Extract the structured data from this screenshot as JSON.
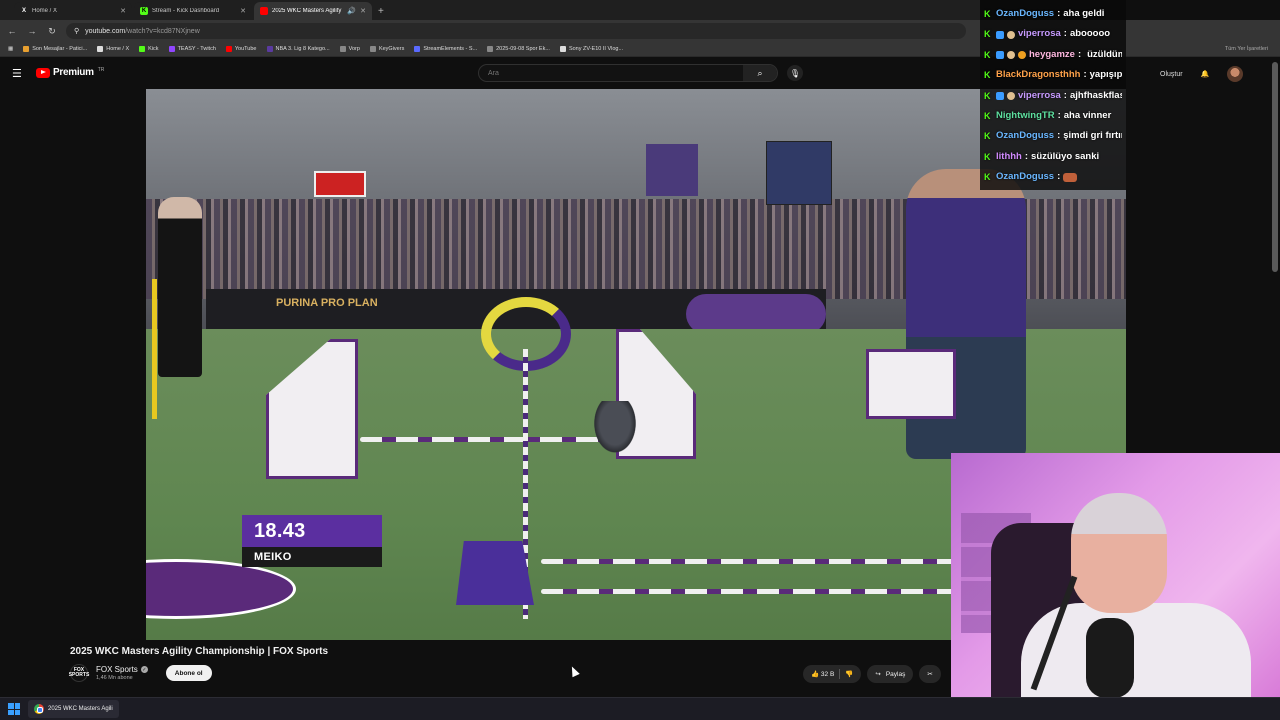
{
  "browser": {
    "tabs": [
      {
        "label": "Home / X",
        "icon": "x-icon",
        "active": false
      },
      {
        "label": "Stream - Kick Dashboard",
        "icon": "kick-icon",
        "active": false
      },
      {
        "label": "2025 WKC Masters Agility",
        "icon": "youtube-icon",
        "active": true
      }
    ],
    "new_tab": "+",
    "url_host": "youtube.com",
    "url_path": "/watch?v=kcd87NXjnew",
    "bookmarks": [
      "Son Mesajlar - Patici...",
      "Home / X",
      "Kick",
      "TEASY - Twitch",
      "YouTube",
      "NBA 3. Lig 8 Katego...",
      "Vorp",
      "KeyGivers",
      "StreamElements - S...",
      "2025-09-08 Spor Ek...",
      "Sony ZV-E10 II Vlog..."
    ],
    "bookmarks_right": "Tüm Yer İşaretleri"
  },
  "youtube": {
    "logo_word": "Premium",
    "logo_region": "TR",
    "search_placeholder": "Ara",
    "create_label": "Oluştur",
    "video_title": "2025 WKC Masters Agility Championship | FOX Sports",
    "channel_logo": "FOX SPORTS",
    "channel_name": "FOX Sports",
    "subscribers": "1,46 Mn abone",
    "subscribe_label": "Abone ol",
    "likes": "32 B",
    "share_label": "Paylaş"
  },
  "video_overlay": {
    "time": "18.43",
    "dog_name": "MEIKO",
    "sponsor": "PURINA PRO PLAN"
  },
  "taskbar": {
    "app_label": "2025 WKC Masters Agili"
  },
  "chat": [
    {
      "user": "OzanDoguss",
      "color": "#6ab7ff",
      "message": "aha geldi",
      "badges": [
        "k"
      ]
    },
    {
      "user": "viperrosa",
      "color": "#c79bff",
      "message": "abooooo",
      "badges": [
        "k",
        "b",
        "face"
      ]
    },
    {
      "user": "heygamze",
      "color": "#ffb8e0",
      "message": "üzüldüm",
      "badges": [
        "k",
        "b",
        "face",
        "coin"
      ],
      "emote": true
    },
    {
      "user": "BlackDragonsthhh",
      "color": "#ffa24a",
      "message": "yapışıp kalmasın",
      "badges": [
        "k"
      ]
    },
    {
      "user": "viperrosa",
      "color": "#c79bff",
      "message": "ajhfhaskflasjfas",
      "badges": [
        "k",
        "b",
        "face"
      ]
    },
    {
      "user": "NightwingTR",
      "color": "#5ee0a0",
      "message": "aha vinner",
      "badges": [
        "k"
      ]
    },
    {
      "user": "OzanDoguss",
      "color": "#6ab7ff",
      "message": "şimdi gri fırtınayı izleyin",
      "badges": [
        "k"
      ]
    },
    {
      "user": "lithhh",
      "color": "#d28bff",
      "message": "süzülüyo sanki",
      "badges": [
        "k"
      ]
    },
    {
      "user": "OzanDoguss",
      "color": "#6ab7ff",
      "message": "",
      "badges": [
        "k"
      ],
      "emote": true
    }
  ],
  "colors": {
    "kick_green": "#53fc18",
    "youtube_red": "#ff0000",
    "overlay_purple": "#5b2fa0"
  }
}
